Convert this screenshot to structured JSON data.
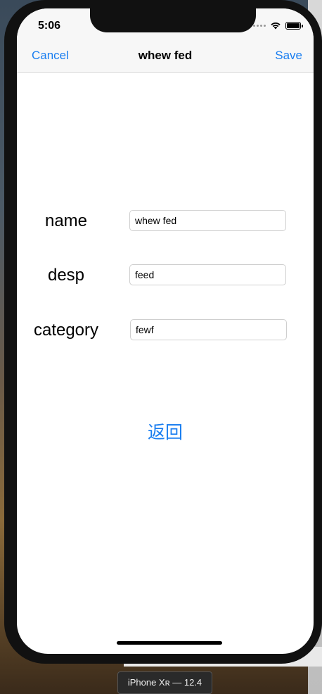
{
  "status_bar": {
    "time": "5:06"
  },
  "nav": {
    "cancel_label": "Cancel",
    "title": "whew fed",
    "save_label": "Save"
  },
  "form": {
    "fields": [
      {
        "label": "name",
        "value": "whew fed"
      },
      {
        "label": "desp",
        "value": "feed"
      },
      {
        "label": "category",
        "value": "fewf"
      }
    ]
  },
  "back_button_label": "返回",
  "simulator_label": "iPhone Xʀ — 12.4",
  "colors": {
    "accent": "#1a7ef0",
    "nav_background": "#f7f7f7",
    "text": "#000000"
  },
  "icons": {
    "signal": "signal-dots-icon",
    "wifi": "wifi-icon",
    "battery": "battery-icon"
  }
}
